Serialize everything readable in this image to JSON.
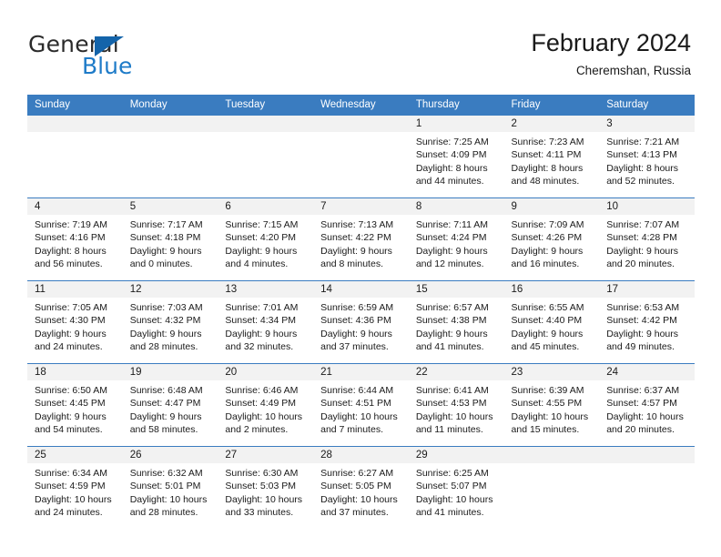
{
  "brand": {
    "word1": "General",
    "word2": "Blue",
    "color_dark": "#2b2b2b",
    "color_blue": "#1e7bc8",
    "triangle_color": "#1464aa"
  },
  "header": {
    "title": "February 2024",
    "subtitle": "Cheremshan, Russia"
  },
  "theme": {
    "header_row_bg": "#3a7cc0",
    "header_row_text": "#ffffff",
    "daynum_band_bg": "#f2f2f2",
    "cell_bg": "#ffffff",
    "row_border": "#3a7cc0"
  },
  "weekday_headers": [
    "Sunday",
    "Monday",
    "Tuesday",
    "Wednesday",
    "Thursday",
    "Friday",
    "Saturday"
  ],
  "weeks": [
    [
      {
        "day": "",
        "lines": []
      },
      {
        "day": "",
        "lines": []
      },
      {
        "day": "",
        "lines": []
      },
      {
        "day": "",
        "lines": []
      },
      {
        "day": "1",
        "lines": [
          "Sunrise: 7:25 AM",
          "Sunset: 4:09 PM",
          "Daylight: 8 hours",
          "and 44 minutes."
        ]
      },
      {
        "day": "2",
        "lines": [
          "Sunrise: 7:23 AM",
          "Sunset: 4:11 PM",
          "Daylight: 8 hours",
          "and 48 minutes."
        ]
      },
      {
        "day": "3",
        "lines": [
          "Sunrise: 7:21 AM",
          "Sunset: 4:13 PM",
          "Daylight: 8 hours",
          "and 52 minutes."
        ]
      }
    ],
    [
      {
        "day": "4",
        "lines": [
          "Sunrise: 7:19 AM",
          "Sunset: 4:16 PM",
          "Daylight: 8 hours",
          "and 56 minutes."
        ]
      },
      {
        "day": "5",
        "lines": [
          "Sunrise: 7:17 AM",
          "Sunset: 4:18 PM",
          "Daylight: 9 hours",
          "and 0 minutes."
        ]
      },
      {
        "day": "6",
        "lines": [
          "Sunrise: 7:15 AM",
          "Sunset: 4:20 PM",
          "Daylight: 9 hours",
          "and 4 minutes."
        ]
      },
      {
        "day": "7",
        "lines": [
          "Sunrise: 7:13 AM",
          "Sunset: 4:22 PM",
          "Daylight: 9 hours",
          "and 8 minutes."
        ]
      },
      {
        "day": "8",
        "lines": [
          "Sunrise: 7:11 AM",
          "Sunset: 4:24 PM",
          "Daylight: 9 hours",
          "and 12 minutes."
        ]
      },
      {
        "day": "9",
        "lines": [
          "Sunrise: 7:09 AM",
          "Sunset: 4:26 PM",
          "Daylight: 9 hours",
          "and 16 minutes."
        ]
      },
      {
        "day": "10",
        "lines": [
          "Sunrise: 7:07 AM",
          "Sunset: 4:28 PM",
          "Daylight: 9 hours",
          "and 20 minutes."
        ]
      }
    ],
    [
      {
        "day": "11",
        "lines": [
          "Sunrise: 7:05 AM",
          "Sunset: 4:30 PM",
          "Daylight: 9 hours",
          "and 24 minutes."
        ]
      },
      {
        "day": "12",
        "lines": [
          "Sunrise: 7:03 AM",
          "Sunset: 4:32 PM",
          "Daylight: 9 hours",
          "and 28 minutes."
        ]
      },
      {
        "day": "13",
        "lines": [
          "Sunrise: 7:01 AM",
          "Sunset: 4:34 PM",
          "Daylight: 9 hours",
          "and 32 minutes."
        ]
      },
      {
        "day": "14",
        "lines": [
          "Sunrise: 6:59 AM",
          "Sunset: 4:36 PM",
          "Daylight: 9 hours",
          "and 37 minutes."
        ]
      },
      {
        "day": "15",
        "lines": [
          "Sunrise: 6:57 AM",
          "Sunset: 4:38 PM",
          "Daylight: 9 hours",
          "and 41 minutes."
        ]
      },
      {
        "day": "16",
        "lines": [
          "Sunrise: 6:55 AM",
          "Sunset: 4:40 PM",
          "Daylight: 9 hours",
          "and 45 minutes."
        ]
      },
      {
        "day": "17",
        "lines": [
          "Sunrise: 6:53 AM",
          "Sunset: 4:42 PM",
          "Daylight: 9 hours",
          "and 49 minutes."
        ]
      }
    ],
    [
      {
        "day": "18",
        "lines": [
          "Sunrise: 6:50 AM",
          "Sunset: 4:45 PM",
          "Daylight: 9 hours",
          "and 54 minutes."
        ]
      },
      {
        "day": "19",
        "lines": [
          "Sunrise: 6:48 AM",
          "Sunset: 4:47 PM",
          "Daylight: 9 hours",
          "and 58 minutes."
        ]
      },
      {
        "day": "20",
        "lines": [
          "Sunrise: 6:46 AM",
          "Sunset: 4:49 PM",
          "Daylight: 10 hours",
          "and 2 minutes."
        ]
      },
      {
        "day": "21",
        "lines": [
          "Sunrise: 6:44 AM",
          "Sunset: 4:51 PM",
          "Daylight: 10 hours",
          "and 7 minutes."
        ]
      },
      {
        "day": "22",
        "lines": [
          "Sunrise: 6:41 AM",
          "Sunset: 4:53 PM",
          "Daylight: 10 hours",
          "and 11 minutes."
        ]
      },
      {
        "day": "23",
        "lines": [
          "Sunrise: 6:39 AM",
          "Sunset: 4:55 PM",
          "Daylight: 10 hours",
          "and 15 minutes."
        ]
      },
      {
        "day": "24",
        "lines": [
          "Sunrise: 6:37 AM",
          "Sunset: 4:57 PM",
          "Daylight: 10 hours",
          "and 20 minutes."
        ]
      }
    ],
    [
      {
        "day": "25",
        "lines": [
          "Sunrise: 6:34 AM",
          "Sunset: 4:59 PM",
          "Daylight: 10 hours",
          "and 24 minutes."
        ]
      },
      {
        "day": "26",
        "lines": [
          "Sunrise: 6:32 AM",
          "Sunset: 5:01 PM",
          "Daylight: 10 hours",
          "and 28 minutes."
        ]
      },
      {
        "day": "27",
        "lines": [
          "Sunrise: 6:30 AM",
          "Sunset: 5:03 PM",
          "Daylight: 10 hours",
          "and 33 minutes."
        ]
      },
      {
        "day": "28",
        "lines": [
          "Sunrise: 6:27 AM",
          "Sunset: 5:05 PM",
          "Daylight: 10 hours",
          "and 37 minutes."
        ]
      },
      {
        "day": "29",
        "lines": [
          "Sunrise: 6:25 AM",
          "Sunset: 5:07 PM",
          "Daylight: 10 hours",
          "and 41 minutes."
        ]
      },
      {
        "day": "",
        "lines": []
      },
      {
        "day": "",
        "lines": []
      }
    ]
  ]
}
